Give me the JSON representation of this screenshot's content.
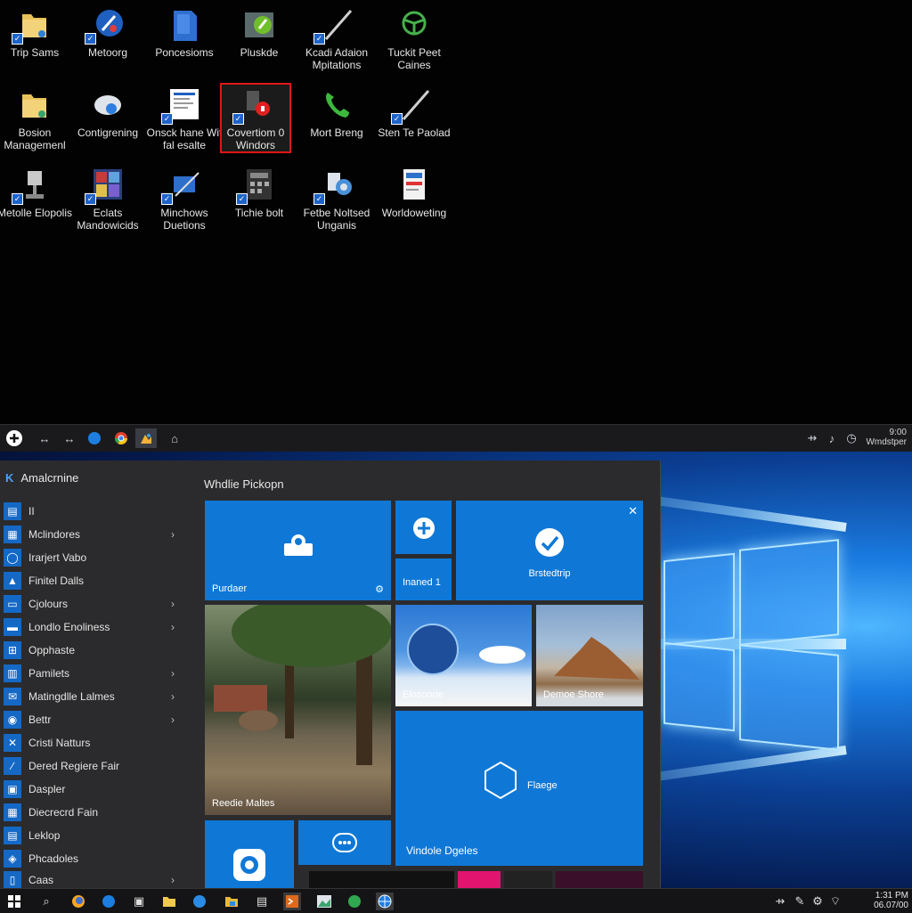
{
  "desktop": {
    "icons": [
      {
        "label": "Trip Sams",
        "icon": "folder-icon"
      },
      {
        "label": "Metoorg",
        "icon": "globe-app-icon"
      },
      {
        "label": "Poncesioms",
        "icon": "blue-box-icon"
      },
      {
        "label": "Pluskde",
        "icon": "green-app-icon"
      },
      {
        "label": "Kcadi Adaion Mpitations",
        "icon": "pen-icon"
      },
      {
        "label": "Tuckit Peet Caines",
        "icon": "steering-wheel-icon"
      },
      {
        "label": "Bosion Managemenl",
        "icon": "folder-icon"
      },
      {
        "label": "Contigrening",
        "icon": "cloud-people-icon"
      },
      {
        "label": "Onsck hane Wit fal esalte",
        "icon": "document-icon"
      },
      {
        "label": "Covertiom 0 Windors",
        "icon": "alert-app-icon",
        "selected": true
      },
      {
        "label": "Mort Breng",
        "icon": "phone-icon"
      },
      {
        "label": "Sten Te Paolad",
        "icon": "pen-icon"
      },
      {
        "label": "Metolle Elopolis",
        "icon": "trophy-icon"
      },
      {
        "label": "Eclats Mandowicids",
        "icon": "media-grid-icon"
      },
      {
        "label": "Minchows Duetions",
        "icon": "window-tool-icon"
      },
      {
        "label": "Tichie bolt",
        "icon": "calculator-icon"
      },
      {
        "label": "Fetbe Noltsed Unganis",
        "icon": "gear-globe-icon"
      },
      {
        "label": "Worldoweting",
        "icon": "form-icon"
      }
    ]
  },
  "topbar": {
    "time": "9:00",
    "date": "Wmdstper"
  },
  "start_menu": {
    "title": "Amalcrnine",
    "tiles_header": "Whdlie Pickopn",
    "list": [
      {
        "label": "II",
        "arrow": false
      },
      {
        "label": "Mclindores",
        "arrow": true
      },
      {
        "label": "Irarjert Vabo",
        "arrow": false
      },
      {
        "label": "Finitel Dalls",
        "arrow": false
      },
      {
        "label": "Cjolours",
        "arrow": true
      },
      {
        "label": "Londlo Enoliness",
        "arrow": true
      },
      {
        "label": "Opphaste",
        "arrow": false
      },
      {
        "label": "Pamilets",
        "arrow": true
      },
      {
        "label": "Matingdlle Lalmes",
        "arrow": true
      },
      {
        "label": "Bettr",
        "arrow": true
      },
      {
        "label": "Cristi Natturs",
        "arrow": false
      },
      {
        "label": "Dered Regiere Fair",
        "arrow": false
      },
      {
        "label": "Daspler",
        "arrow": false
      },
      {
        "label": "Diecrecrd Fain",
        "arrow": false
      },
      {
        "label": "Leklop",
        "arrow": false
      },
      {
        "label": "Phcadoles",
        "arrow": false
      },
      {
        "label": "Caas",
        "arrow": true
      }
    ],
    "tiles": {
      "purdaer": "Purdaer",
      "inaned": "Inaned 1",
      "bastedtrip": "Brstedtrip",
      "forest": "Reedie Maltes",
      "sky": "Elosoone",
      "rock": "Demoe Shore",
      "flaege": "Flaege",
      "vindole": "Vindole Dgeles"
    }
  },
  "taskbar": {
    "time": "1:31 PM",
    "date": "06.07/00"
  },
  "colors": {
    "accent": "#0f78d6",
    "selection": "#e01616",
    "menu_bg": "#2b2b2d"
  }
}
